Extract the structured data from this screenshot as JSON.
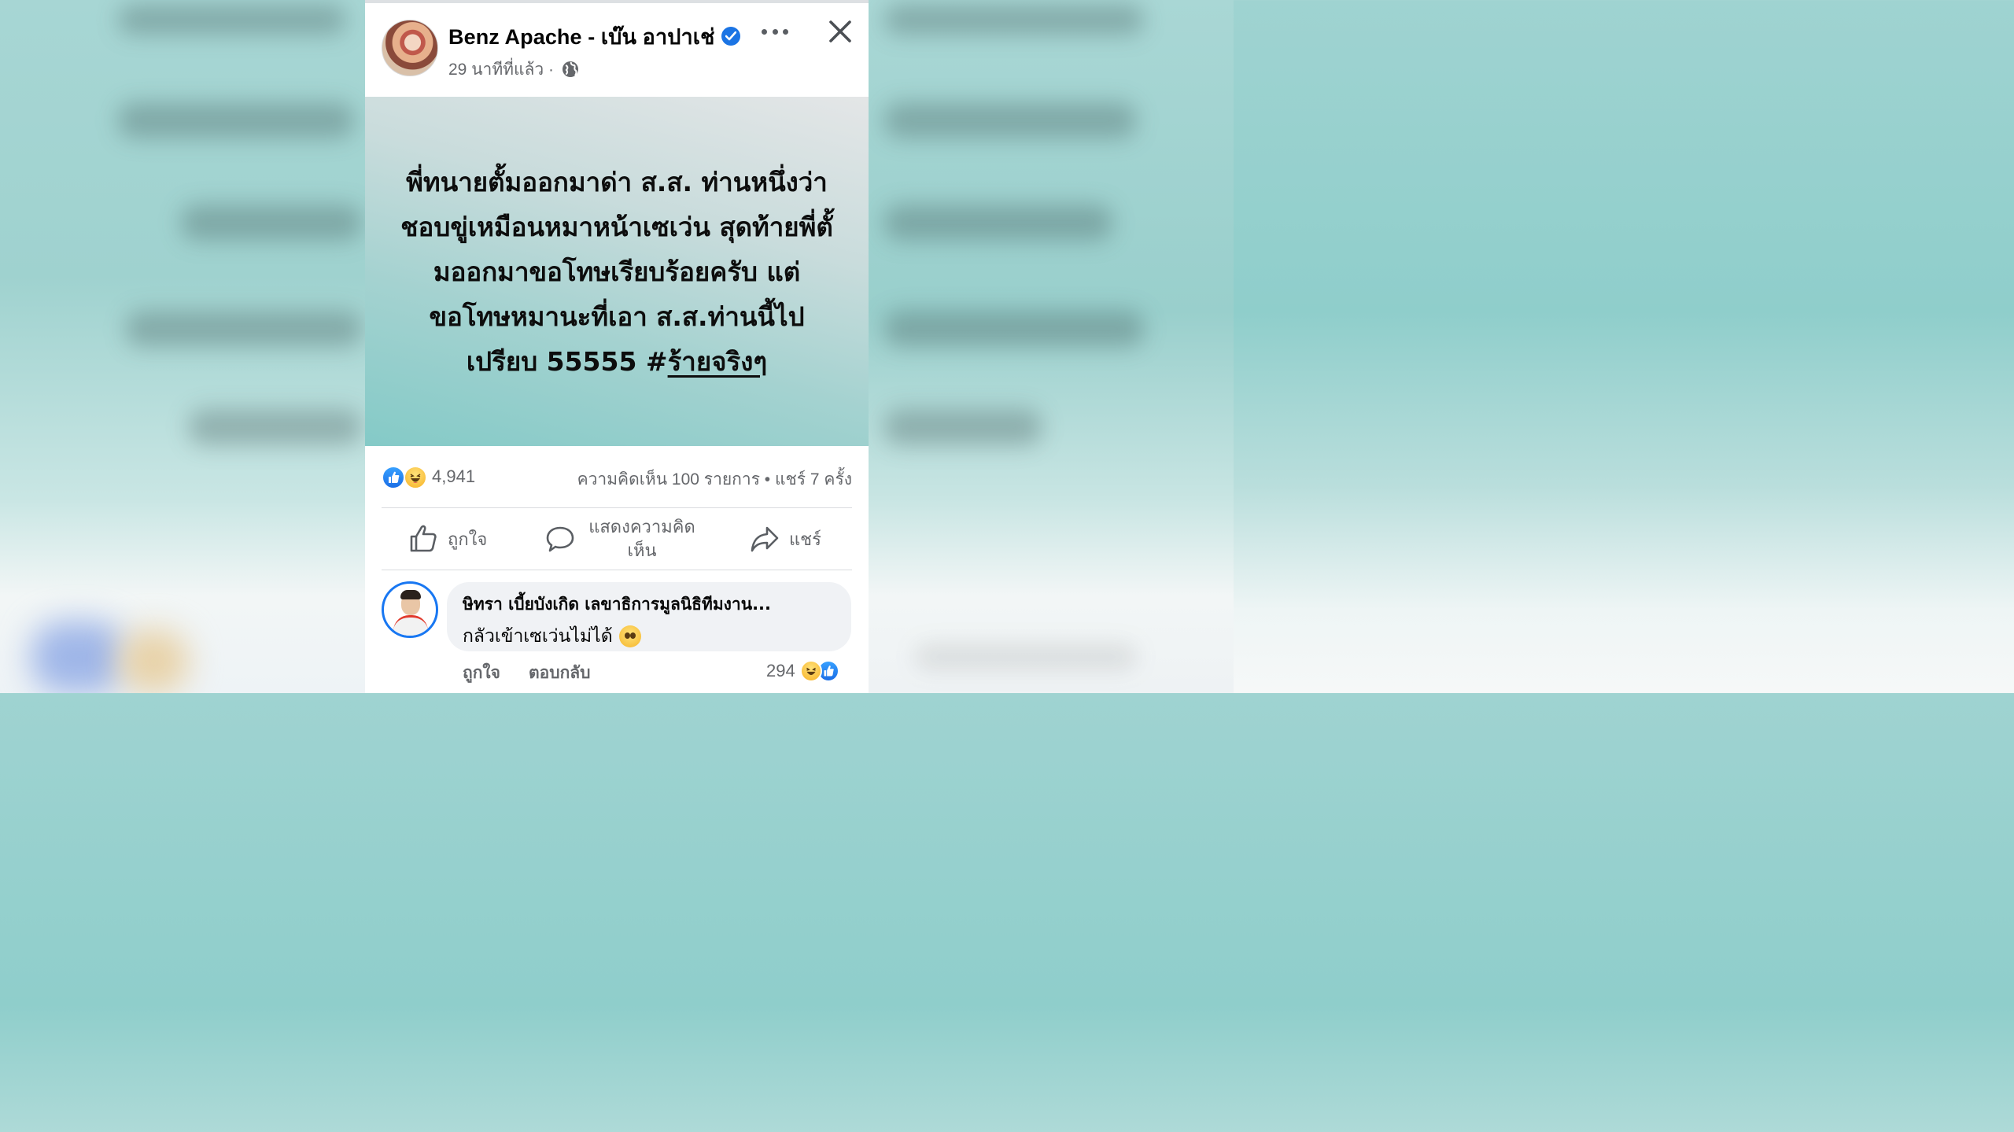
{
  "post": {
    "author": "Benz Apache - เบ๊น อาปาเช่",
    "time": "29 นาทีที่แล้ว ·",
    "banner_text": "พี่ทนายตั้มออกมาด่า ส.ส. ท่านหนึ่งว่าชอบขู่เหมือนหมาหน้าเซเว่น สุดท้ายพี่ตั้มออกมาขอโทษเรียบร้อยครับ แต่ขอโทษหมานะที่เอา ส.ส.ท่านนี้ไปเปรียบ 55555 #",
    "banner_hashtag": "ร้ายจริงๆ"
  },
  "stats": {
    "reaction_count": "4,941",
    "comments_shares": "ความคิดเห็น 100 รายการ • แชร์ 7 ครั้ง"
  },
  "actions": {
    "like": "ถูกใจ",
    "comment": "แสดงความคิดเห็น",
    "share": "แชร์"
  },
  "comment": {
    "name": "ษิทรา เบี้ยบังเกิด เลขาธิการมูลนิธิทีมงาน...",
    "text": "กลัวเข้าเซเว่นไม่ได้",
    "like_label": "ถูกใจ",
    "reply_label": "ตอบกลับ",
    "reaction_count": "294"
  },
  "icons": {
    "verified": "verified-badge-icon",
    "more": "more-options-icon",
    "close": "close-icon",
    "privacy": "globe-icon",
    "like": "thumbs-up-icon",
    "comment": "speech-bubble-icon",
    "share": "share-arrow-icon"
  },
  "colors": {
    "accent": "#1877f2",
    "secondary_text": "#65676b"
  }
}
